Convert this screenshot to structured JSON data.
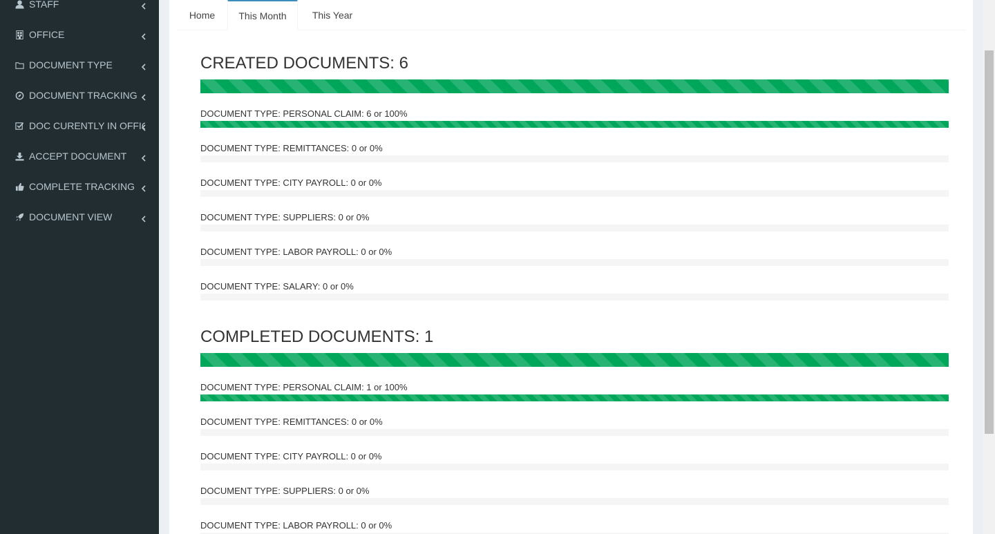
{
  "sidebar": {
    "items": [
      {
        "label": "STAFF",
        "icon": "user-icon"
      },
      {
        "label": "OFFICE",
        "icon": "building-icon"
      },
      {
        "label": "DOCUMENT TYPE",
        "icon": "folder-icon"
      },
      {
        "label": "DOCUMENT TRACKING",
        "icon": "compass-icon"
      },
      {
        "label": "DOC CURENTLY IN OFFICE",
        "icon": "checkbox-icon"
      },
      {
        "label": "ACCEPT DOCUMENT",
        "icon": "download-icon"
      },
      {
        "label": "COMPLETE TRACKING",
        "icon": "thumbs-up-icon"
      },
      {
        "label": "DOCUMENT VIEW",
        "icon": "rocket-icon"
      }
    ]
  },
  "tabs": [
    {
      "label": "Home",
      "active": false
    },
    {
      "label": "This Month",
      "active": true
    },
    {
      "label": "This Year",
      "active": false
    }
  ],
  "created": {
    "title": "CREATED DOCUMENTS: 6",
    "progress": 1.0,
    "rows": [
      {
        "label": "DOCUMENT TYPE: PERSONAL CLAIM: 6 or 100%",
        "fraction": 1.0
      },
      {
        "label": "DOCUMENT TYPE: REMITTANCES: 0 or 0%",
        "fraction": 0
      },
      {
        "label": "DOCUMENT TYPE: CITY PAYROLL: 0 or 0%",
        "fraction": 0
      },
      {
        "label": "DOCUMENT TYPE: SUPPLIERS: 0 or 0%",
        "fraction": 0
      },
      {
        "label": "DOCUMENT TYPE: LABOR PAYROLL: 0 or 0%",
        "fraction": 0
      },
      {
        "label": "DOCUMENT TYPE: SALARY: 0 or 0%",
        "fraction": 0
      }
    ]
  },
  "completed": {
    "title": "COMPLETED DOCUMENTS: 1",
    "progress": 1.0,
    "rows": [
      {
        "label": "DOCUMENT TYPE: PERSONAL CLAIM: 1 or 100%",
        "fraction": 1.0
      },
      {
        "label": "DOCUMENT TYPE: REMITTANCES: 0 or 0%",
        "fraction": 0
      },
      {
        "label": "DOCUMENT TYPE: CITY PAYROLL: 0 or 0%",
        "fraction": 0
      },
      {
        "label": "DOCUMENT TYPE: SUPPLIERS: 0 or 0%",
        "fraction": 0
      },
      {
        "label": "DOCUMENT TYPE: LABOR PAYROLL: 0 or 0%",
        "fraction": 0
      }
    ]
  },
  "colors": {
    "sidebar_bg": "#222d32",
    "sidebar_text": "#b8c7ce",
    "progress_green": "#00a65a",
    "tab_accent": "#3c8dbc"
  }
}
